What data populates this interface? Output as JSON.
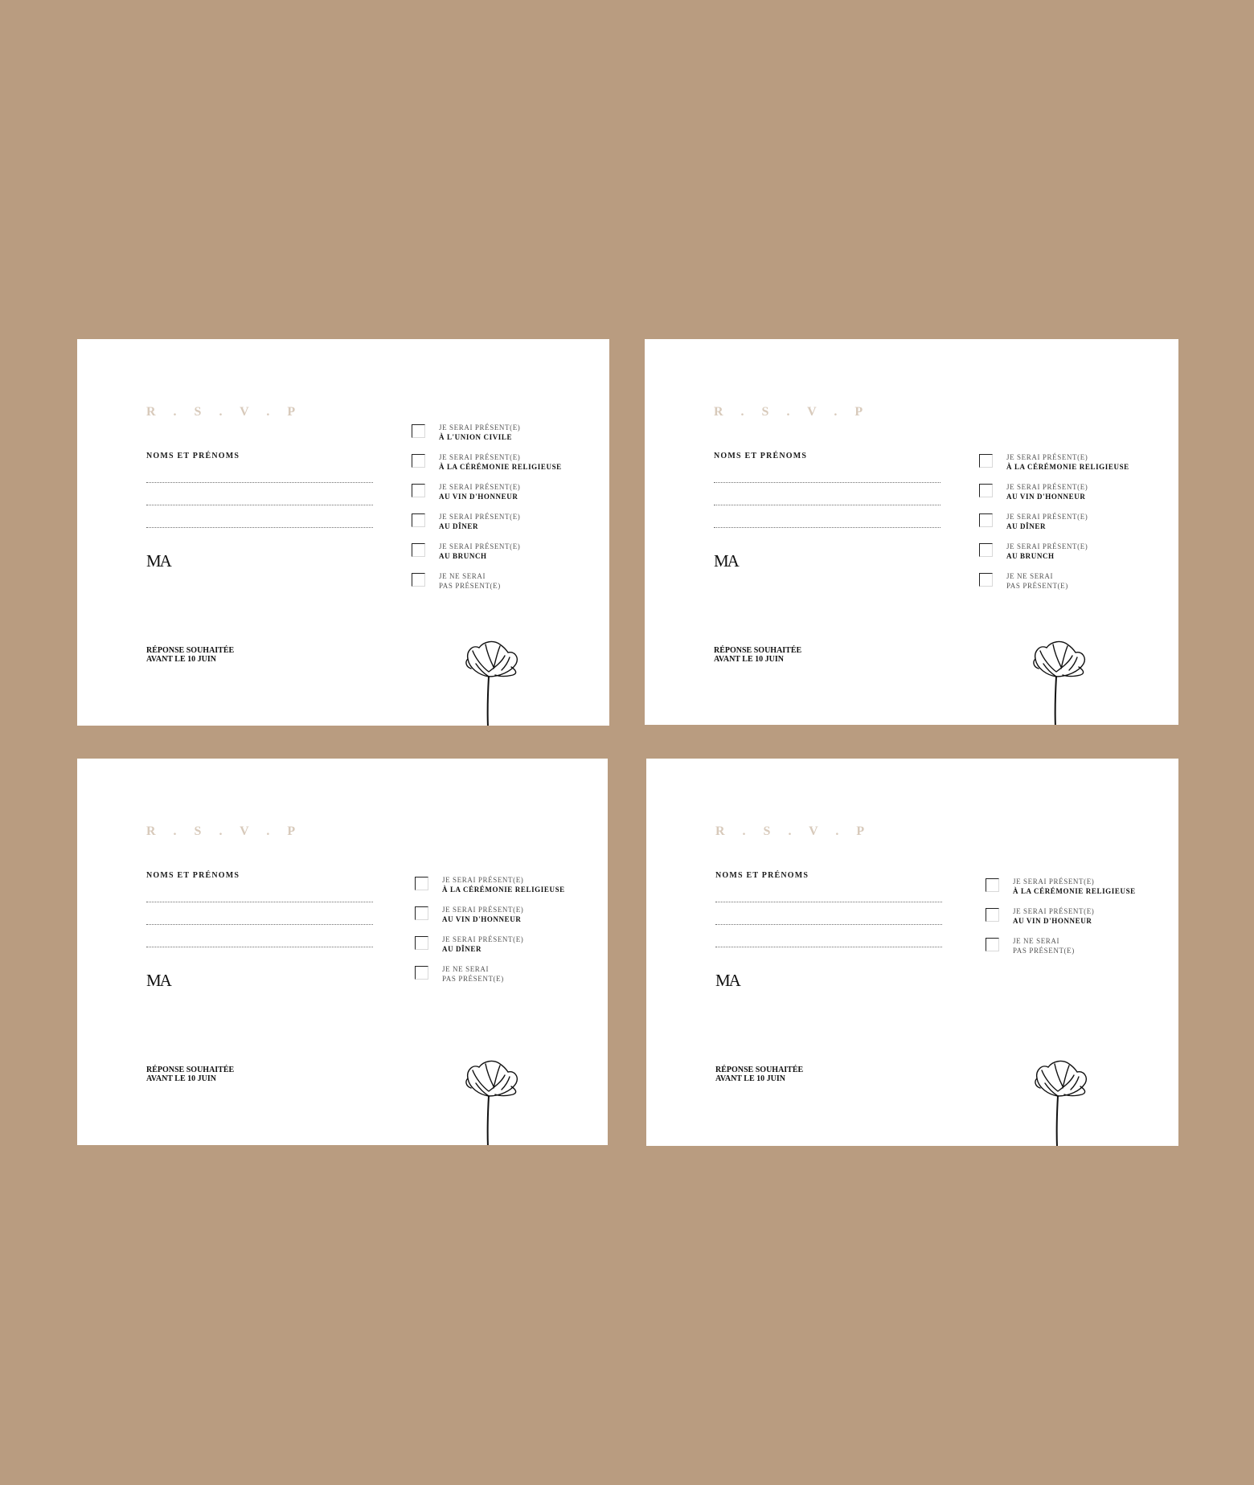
{
  "cards": [
    {
      "title": "R . S . V . P",
      "names_label": "Noms et prénoms",
      "monogram": "MA",
      "deadline_line1": "Réponse souhaitée",
      "deadline_line2": "avant le 10 juin",
      "options": [
        {
          "line1": "Je serai présent(e)",
          "line2": "à l'union civile"
        },
        {
          "line1": "Je serai présent(e)",
          "line2": "à la cérémonie religieuse"
        },
        {
          "line1": "Je serai présent(e)",
          "line2": "au vin d'honneur"
        },
        {
          "line1": "Je serai présent(e)",
          "line2": "au dîner"
        },
        {
          "line1": "Je serai présent(e)",
          "line2": "au brunch"
        },
        {
          "line1": "Je ne serai",
          "line2": "pas présent(e)"
        }
      ]
    },
    {
      "title": "R . S . V . P",
      "names_label": "Noms et prénoms",
      "monogram": "MA",
      "deadline_line1": "Réponse souhaitée",
      "deadline_line2": "avant le 10 juin",
      "options": [
        {
          "line1": "Je serai présent(e)",
          "line2": "à la cérémonie religieuse"
        },
        {
          "line1": "Je serai présent(e)",
          "line2": "au vin d'honneur"
        },
        {
          "line1": "Je serai présent(e)",
          "line2": "au dîner"
        },
        {
          "line1": "Je serai présent(e)",
          "line2": "au brunch"
        },
        {
          "line1": "Je ne serai",
          "line2": "pas présent(e)"
        }
      ]
    },
    {
      "title": "R . S . V . P",
      "names_label": "Noms et prénoms",
      "monogram": "MA",
      "deadline_line1": "Réponse souhaitée",
      "deadline_line2": "avant le 10 juin",
      "options": [
        {
          "line1": "Je serai présent(e)",
          "line2": "à la cérémonie religieuse"
        },
        {
          "line1": "Je serai présent(e)",
          "line2": "au vin d'honneur"
        },
        {
          "line1": "Je serai présent(e)",
          "line2": "au dîner"
        },
        {
          "line1": "Je ne serai",
          "line2": "pas présent(e)"
        }
      ]
    },
    {
      "title": "R . S . V . P",
      "names_label": "Noms et prénoms",
      "monogram": "MA",
      "deadline_line1": "Réponse souhaitée",
      "deadline_line2": "avant le 10 juin",
      "options": [
        {
          "line1": "Je serai présent(e)",
          "line2": "à la cérémonie religieuse"
        },
        {
          "line1": "Je serai présent(e)",
          "line2": "au vin d'honneur"
        },
        {
          "line1": "Je ne serai",
          "line2": "pas présent(e)"
        }
      ]
    }
  ]
}
